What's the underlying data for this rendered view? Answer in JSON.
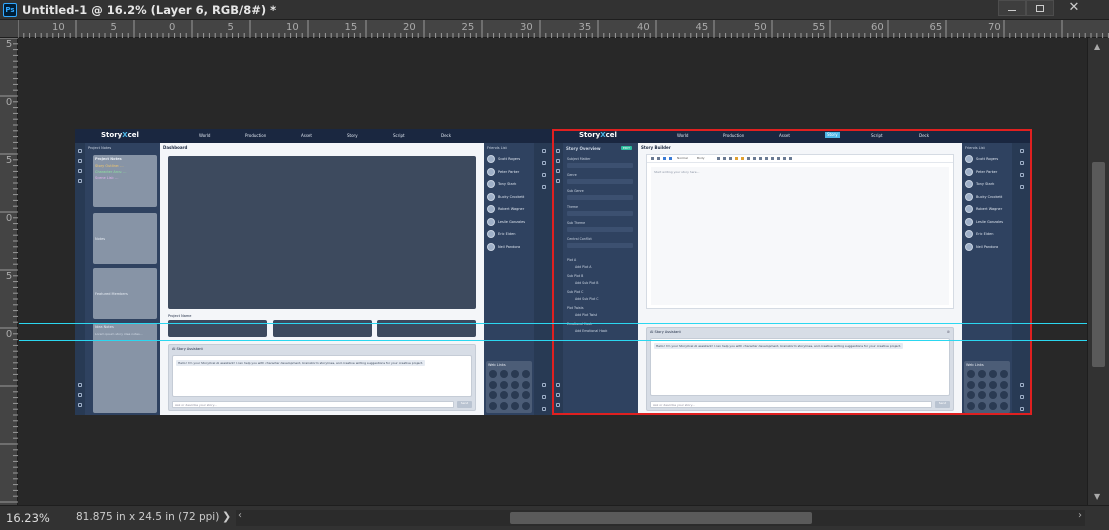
{
  "window": {
    "app_icon": "Ps",
    "title": "Untitled-1 @ 16.2% (Layer 6, RGB/8#) *",
    "buttons": {
      "minimize": "minimize-icon",
      "maximize": "maximize-icon",
      "close": "close-icon"
    }
  },
  "ruler": {
    "top_labels": [
      "10",
      "5",
      "0",
      "5",
      "10",
      "15",
      "20",
      "25",
      "30",
      "35",
      "40",
      "45",
      "50",
      "55",
      "60",
      "65",
      "70"
    ],
    "left_labels": [
      "5",
      "0",
      "5",
      "0",
      "5",
      "0"
    ]
  },
  "status": {
    "zoom": "16.23%",
    "doc_size": "81.875 in x 24.5 in (72 ppi)",
    "arrow": "❯"
  },
  "board1": {
    "logo_a": "Story",
    "logo_x": "X",
    "logo_b": "cel",
    "nav": [
      "World",
      "Production",
      "Asset",
      "Story",
      "Script",
      "Deck"
    ],
    "side_header": "Project Notes",
    "card1_lines": [
      "Project Notes",
      "Story Outline: ...",
      "Character Arcs: ...",
      "Scene List: ..."
    ],
    "card2_label": "Notes",
    "card3_label": "Featured Members",
    "card4_label": "Idea Notes",
    "card4_text": "Lorem ipsum story idea notes...",
    "main_title": "Dashboard",
    "project_title": "Project Name",
    "chat_title": "AI Story Assistant",
    "chat_msg": "Hello! I'm your StoryXcel AI assistant! I can help you with character development, brainstorm storylines, and creative writing suggestions for your creative project.",
    "chat_placeholder": "Ask or describe your story...",
    "chat_send": "Send",
    "friends_title": "Friends List",
    "friends": [
      "Scott Rogers",
      "Peter Parker",
      "Tony Stark",
      "Bucky Crockett",
      "Robert Wagner",
      "Leslie Gonzales",
      "Eric Eiden",
      "Neil Pandora"
    ],
    "weblinks_title": "Web Links"
  },
  "board2": {
    "logo_a": "Story",
    "logo_x": "X",
    "logo_b": "cel",
    "nav": [
      "World",
      "Production",
      "Asset",
      "Story",
      "Script",
      "Deck"
    ],
    "active_nav": "Story",
    "overview_title": "Story Overview",
    "overview_badge": "EDIT",
    "overview_items": [
      "Subject Matter",
      "Genre",
      "Sub Genre",
      "Theme",
      "Sub Theme",
      "Central Conflict"
    ],
    "plot_items": [
      {
        "label": "Plot A",
        "sub": "Add Plot A"
      },
      {
        "label": "Sub Plot B",
        "sub": "Add Sub Plot B"
      },
      {
        "label": "Sub Plot C",
        "sub": "Add Sub Plot C"
      },
      {
        "label": "Plot Twists",
        "sub": "Add Plot Twist"
      },
      {
        "label": "Emotional Hook",
        "sub": "Add Emotional Hook"
      }
    ],
    "builder_title": "Story Builder",
    "toolbar_font": "Normal",
    "toolbar_size": "Body",
    "editor_placeholder": "Start writing your story here...",
    "chat_title": "AI Story Assistant",
    "chat_msg": "Hello! I'm your StoryXcel AI assistant! I can help you with character development, brainstorm storylines, and creative writing suggestions for your creative project.",
    "chat_placeholder": "Ask or describe your story...",
    "chat_send": "Send",
    "friends_title": "Friends List",
    "friends": [
      "Scott Rogers",
      "Peter Parker",
      "Tony Stark",
      "Bucky Crockett",
      "Robert Wagner",
      "Leslie Gonzales",
      "Eric Eiden",
      "Neil Pandora"
    ],
    "weblinks_title": "Web Links"
  },
  "colors": {
    "app_bg": "#282828",
    "panel": "#323232",
    "selection": "#e02020",
    "guide": "#2bd7f0",
    "nav": "#1a2740",
    "accent": "#4db6e6"
  }
}
